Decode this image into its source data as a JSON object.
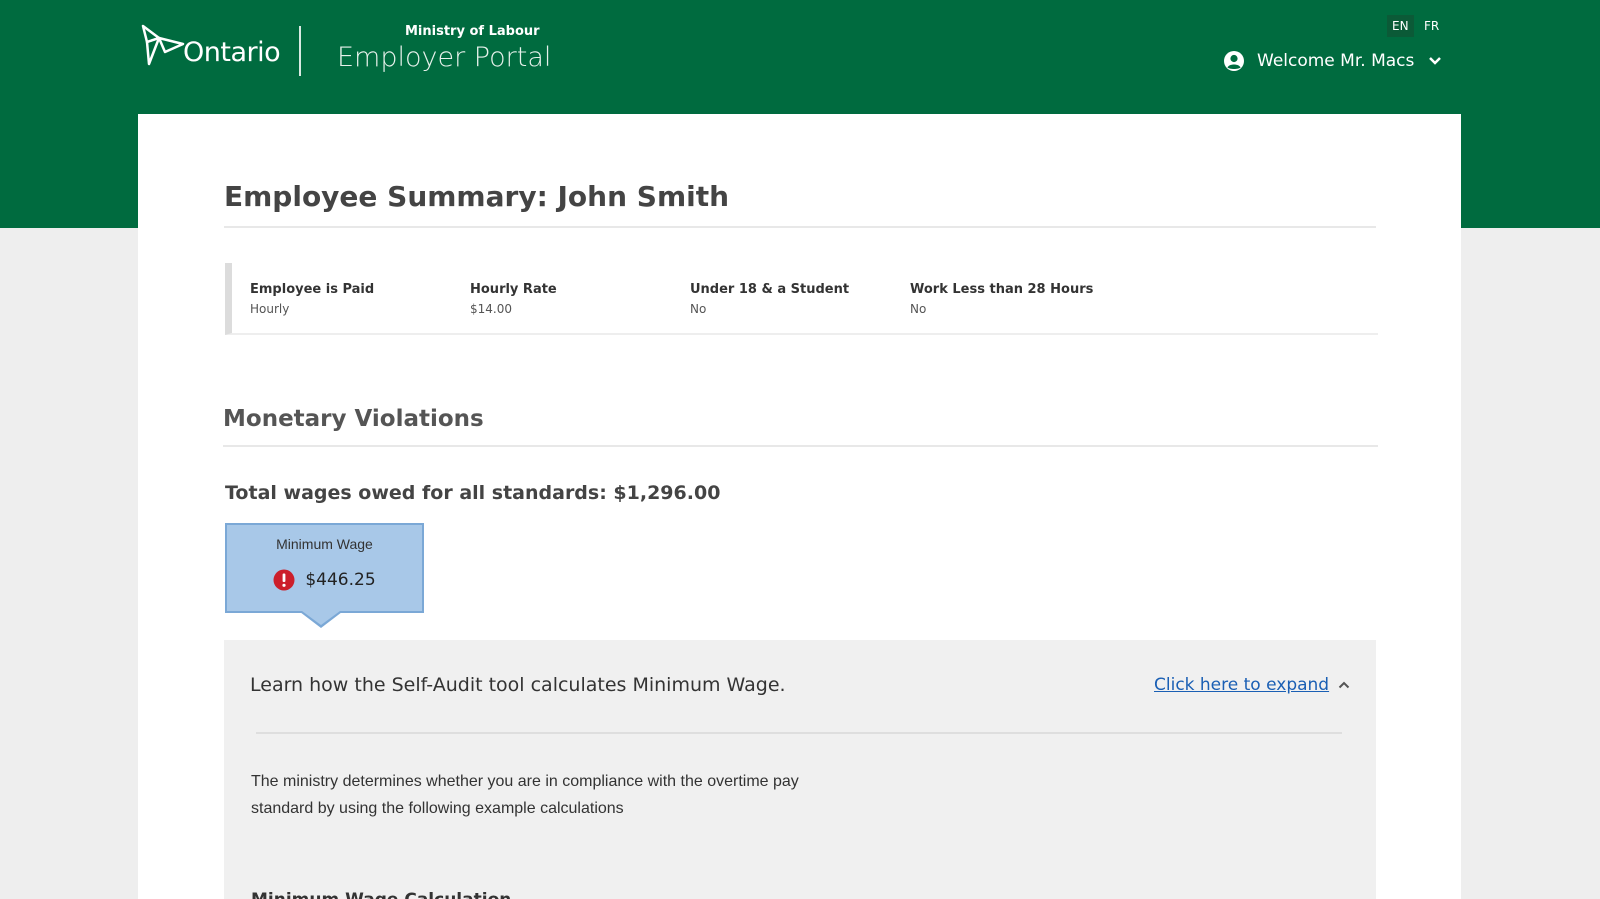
{
  "header": {
    "logo_text": "Ontario",
    "ministry": "Ministry of Labour",
    "portal": "Employer Portal",
    "lang_en": "EN",
    "lang_fr": "FR",
    "welcome": "Welcome Mr. Macs"
  },
  "page": {
    "title": "Employee Summary: John Smith"
  },
  "summary": [
    {
      "label": "Employee is Paid",
      "value": "Hourly"
    },
    {
      "label": "Hourly Rate",
      "value": "$14.00"
    },
    {
      "label": "Under 18 & a Student",
      "value": "No"
    },
    {
      "label": "Work Less than 28 Hours",
      "value": "No"
    }
  ],
  "violations": {
    "title": "Monetary Violations",
    "total": "Total wages owed for all standards: $1,296.00",
    "tile_label": "Minimum Wage",
    "tile_amount": "$446.25"
  },
  "panel": {
    "title": "Learn how the Self-Audit tool calculates Minimum Wage.",
    "expand": "Click here to expand",
    "body": "The ministry determines whether you are in compliance with the overtime pay standard by using the following example calculations",
    "next_heading": "Minimum Wage Calculation"
  },
  "colors": {
    "brand_green": "#006b3f",
    "tile_blue": "#a8c8e8",
    "alert_red": "#cc1f2b",
    "link_blue": "#1a5fb4"
  }
}
